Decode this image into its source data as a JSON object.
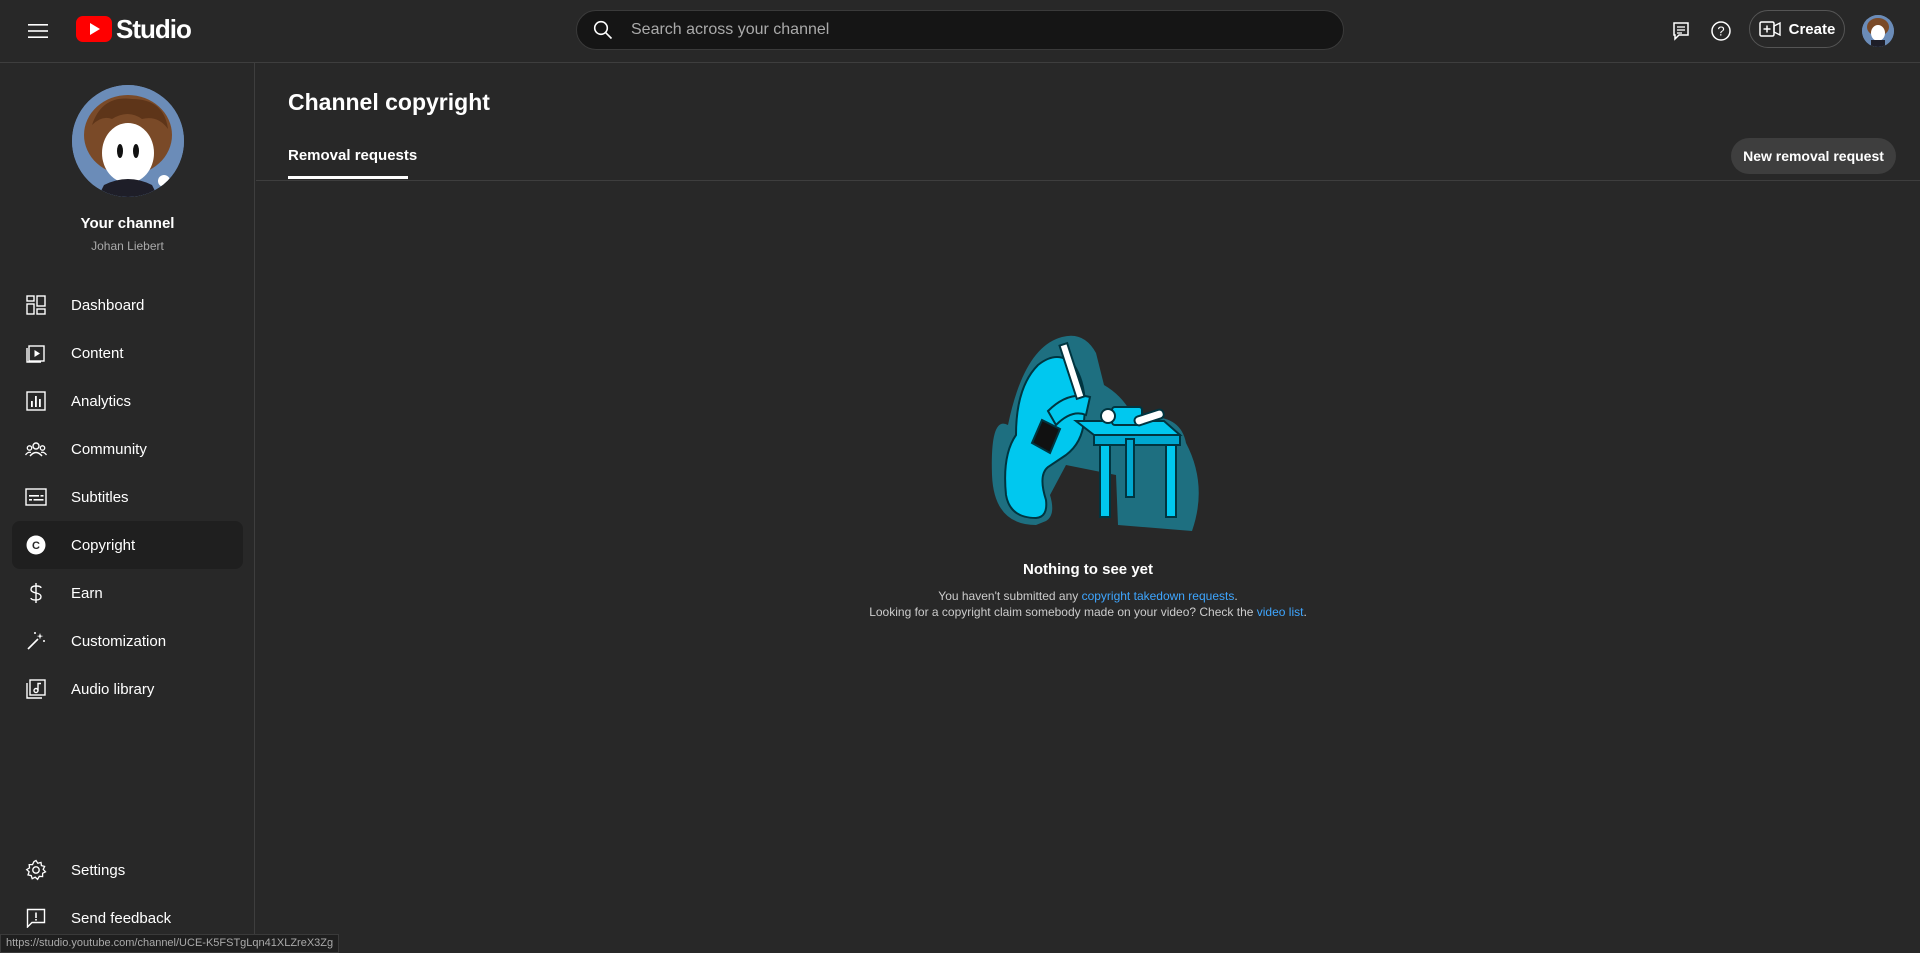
{
  "header": {
    "logo_text": "Studio",
    "search_placeholder": "Search across your channel",
    "create_label": "Create"
  },
  "sidebar": {
    "channel_title": "Your channel",
    "channel_name": "Johan Liebert",
    "items": [
      {
        "label": "Dashboard",
        "icon": "dashboard-icon"
      },
      {
        "label": "Content",
        "icon": "content-icon"
      },
      {
        "label": "Analytics",
        "icon": "analytics-icon"
      },
      {
        "label": "Community",
        "icon": "community-icon"
      },
      {
        "label": "Subtitles",
        "icon": "subtitles-icon"
      },
      {
        "label": "Copyright",
        "icon": "copyright-icon",
        "active": true
      },
      {
        "label": "Earn",
        "icon": "dollar-icon"
      },
      {
        "label": "Customization",
        "icon": "magic-wand-icon"
      },
      {
        "label": "Audio library",
        "icon": "audio-library-icon"
      }
    ],
    "settings_label": "Settings",
    "feedback_label": "Send feedback"
  },
  "main": {
    "title": "Channel copyright",
    "tab_label": "Removal requests",
    "new_button_label": "New removal request",
    "empty": {
      "title": "Nothing to see yet",
      "line1_prefix": "You haven't submitted any ",
      "line1_link": "copyright takedown requests",
      "line1_suffix": ".",
      "line2_prefix": "Looking for a copyright claim somebody made on your video? Check the ",
      "line2_link": "video list",
      "line2_suffix": "."
    }
  },
  "status_url": "https://studio.youtube.com/channel/UCE-K5FSTgLqn41XLZreX3Zg",
  "colors": {
    "background": "#282828",
    "brand_red": "#ff0000",
    "link": "#3ea6ff",
    "illustration_cyan": "#00c8ef"
  }
}
